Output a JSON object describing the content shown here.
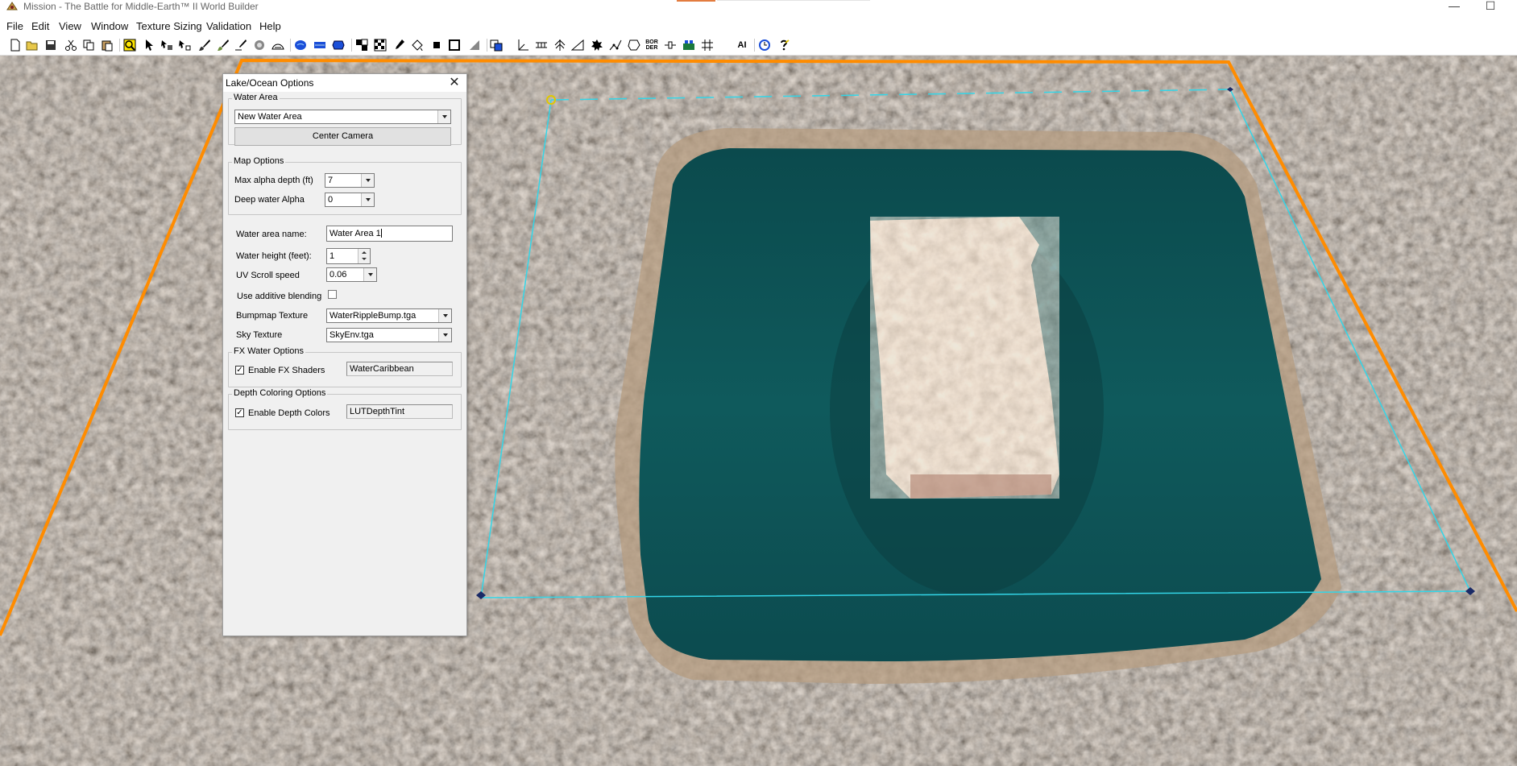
{
  "window": {
    "title": "Mission - The Battle for Middle-Earth™ II World Builder",
    "minimize_glyph": "—",
    "maximize_glyph": "☐"
  },
  "menu": {
    "items": [
      "File",
      "Edit",
      "View",
      "Window",
      "Texture Sizing",
      "Validation",
      "Help"
    ]
  },
  "toolbar": {
    "text_buttons": {
      "border": "BOR\nDER",
      "ai": "AI"
    },
    "icons": [
      "new-icon",
      "open-icon",
      "save-icon",
      "cut-icon",
      "copy-icon",
      "paste-icon",
      "zoom-icon",
      "pointer-icon",
      "select-object-icon",
      "waypoint-icon",
      "brush-icon",
      "tile-brush-icon",
      "feather-brush-icon",
      "blend-icon",
      "light-icon",
      "mound-icon",
      "water-icon",
      "road-icon",
      "ramp-icon",
      "checker-icon",
      "pattern-icon",
      "eyedropper-icon",
      "fill-icon",
      "square-icon",
      "outline-square-icon",
      "flatten-icon",
      "copy-area-icon",
      "axis-icon",
      "ruler-icon",
      "tree-icon",
      "slope-icon",
      "scorch-icon",
      "path-icon",
      "polygon-icon",
      "border-icon",
      "link-icon",
      "build-list-icon",
      "grid-icon",
      "ai-icon",
      "undo-history-icon",
      "help-icon"
    ]
  },
  "colors": {
    "map_border": "#ff8c00",
    "water_area_outline": "#33d6e8",
    "water": "#0f5a5c",
    "dialog_bg": "#f0f0f0"
  },
  "dialog": {
    "title": "Lake/Ocean Options",
    "close_glyph": "✕",
    "water_area": {
      "label": "Water Area",
      "selected": "New Water Area",
      "center_camera": "Center Camera"
    },
    "map_options": {
      "label": "Map Options",
      "max_alpha_depth_label": "Max alpha depth (ft)",
      "max_alpha_depth_value": "7",
      "deep_water_alpha_label": "Deep water Alpha",
      "deep_water_alpha_value": "0"
    },
    "water_area_name_label": "Water area name:",
    "water_area_name_value": "Water Area 1",
    "water_height_label": "Water height (feet):",
    "water_height_value": "1",
    "uv_scroll_label": "UV Scroll speed",
    "uv_scroll_value": "0.06",
    "additive_blending_label": "Use additive blending",
    "additive_blending_checked": false,
    "bumpmap_label": "Bumpmap Texture",
    "bumpmap_value": "WaterRippleBump.tga",
    "sky_label": "Sky Texture",
    "sky_value": "SkyEnv.tga",
    "fx": {
      "label": "FX Water Options",
      "enable_label": "Enable FX Shaders",
      "checked_glyph": "✓",
      "shader_value": "WaterCaribbean"
    },
    "depth": {
      "label": "Depth Coloring Options",
      "enable_label": "Enable Depth Colors",
      "checked_glyph": "✓",
      "lut_value": "LUTDepthTint"
    }
  }
}
